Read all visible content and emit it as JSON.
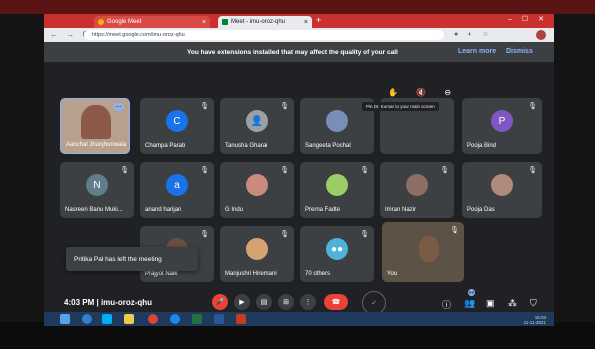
{
  "browser": {
    "tabs": [
      {
        "label": "Google Meet"
      },
      {
        "label": "Meet - imu-oroz-qhu"
      }
    ],
    "new_tab": "+",
    "window_controls": "–  ☐  ✕",
    "url": "https://meet.google.com/imu-oroz-qhu"
  },
  "banner": {
    "message": "You have extensions installed that may affect the quality of your call",
    "learn_more": "Learn more",
    "dismiss": "Dismiss"
  },
  "participants": [
    {
      "name": "Aanchal Jhunjhunwala",
      "kind": "photo",
      "color": "#c79a87"
    },
    {
      "name": "Champa Parab",
      "kind": "letter",
      "letter": "C",
      "color": "#1a73e8"
    },
    {
      "name": "Tanusha Gharai",
      "kind": "icon",
      "color": "#9aa0a6"
    },
    {
      "name": "Sangeeta Pochal",
      "kind": "photo",
      "color": "#7a8fb8"
    },
    {
      "name": "",
      "kind": "blank"
    },
    {
      "name": "Pooja Bind",
      "kind": "letter",
      "letter": "P",
      "color": "#7e57c2"
    },
    {
      "name": "Nasreen Banu Muki...",
      "kind": "letter",
      "letter": "N",
      "color": "#607d8b"
    },
    {
      "name": "anand harijan",
      "kind": "letter",
      "letter": "a",
      "color": "#1a73e8"
    },
    {
      "name": "G Indu",
      "kind": "photo",
      "color": "#c98b7b"
    },
    {
      "name": "Prerna Fadte",
      "kind": "photo",
      "color": "#9ccc65"
    },
    {
      "name": "Imran Nazir",
      "kind": "photo",
      "color": "#8d6e63"
    },
    {
      "name": "Pooja Das",
      "kind": "photo",
      "color": "#b08a7a"
    },
    {
      "name": "Prajyot Naik",
      "kind": "photo",
      "color": "#6d4c41"
    },
    {
      "name": "Manjushri Hiremani",
      "kind": "photo",
      "color": "#d4a373"
    },
    {
      "name": "70 others",
      "kind": "group",
      "color": "#4fb3d9"
    },
    {
      "name": "You",
      "kind": "self",
      "color": "#8a7a6a"
    }
  ],
  "tooltip": "Pin Dr. Kumar to your main screen",
  "toast": "Pritika Pal has left the meeting",
  "meeting": {
    "time": "4:03 PM",
    "separator": "|",
    "code": "imu-oroz-qhu"
  },
  "right_badge": "69",
  "tray": {
    "time": "16:03",
    "date": "11-11-2021"
  }
}
